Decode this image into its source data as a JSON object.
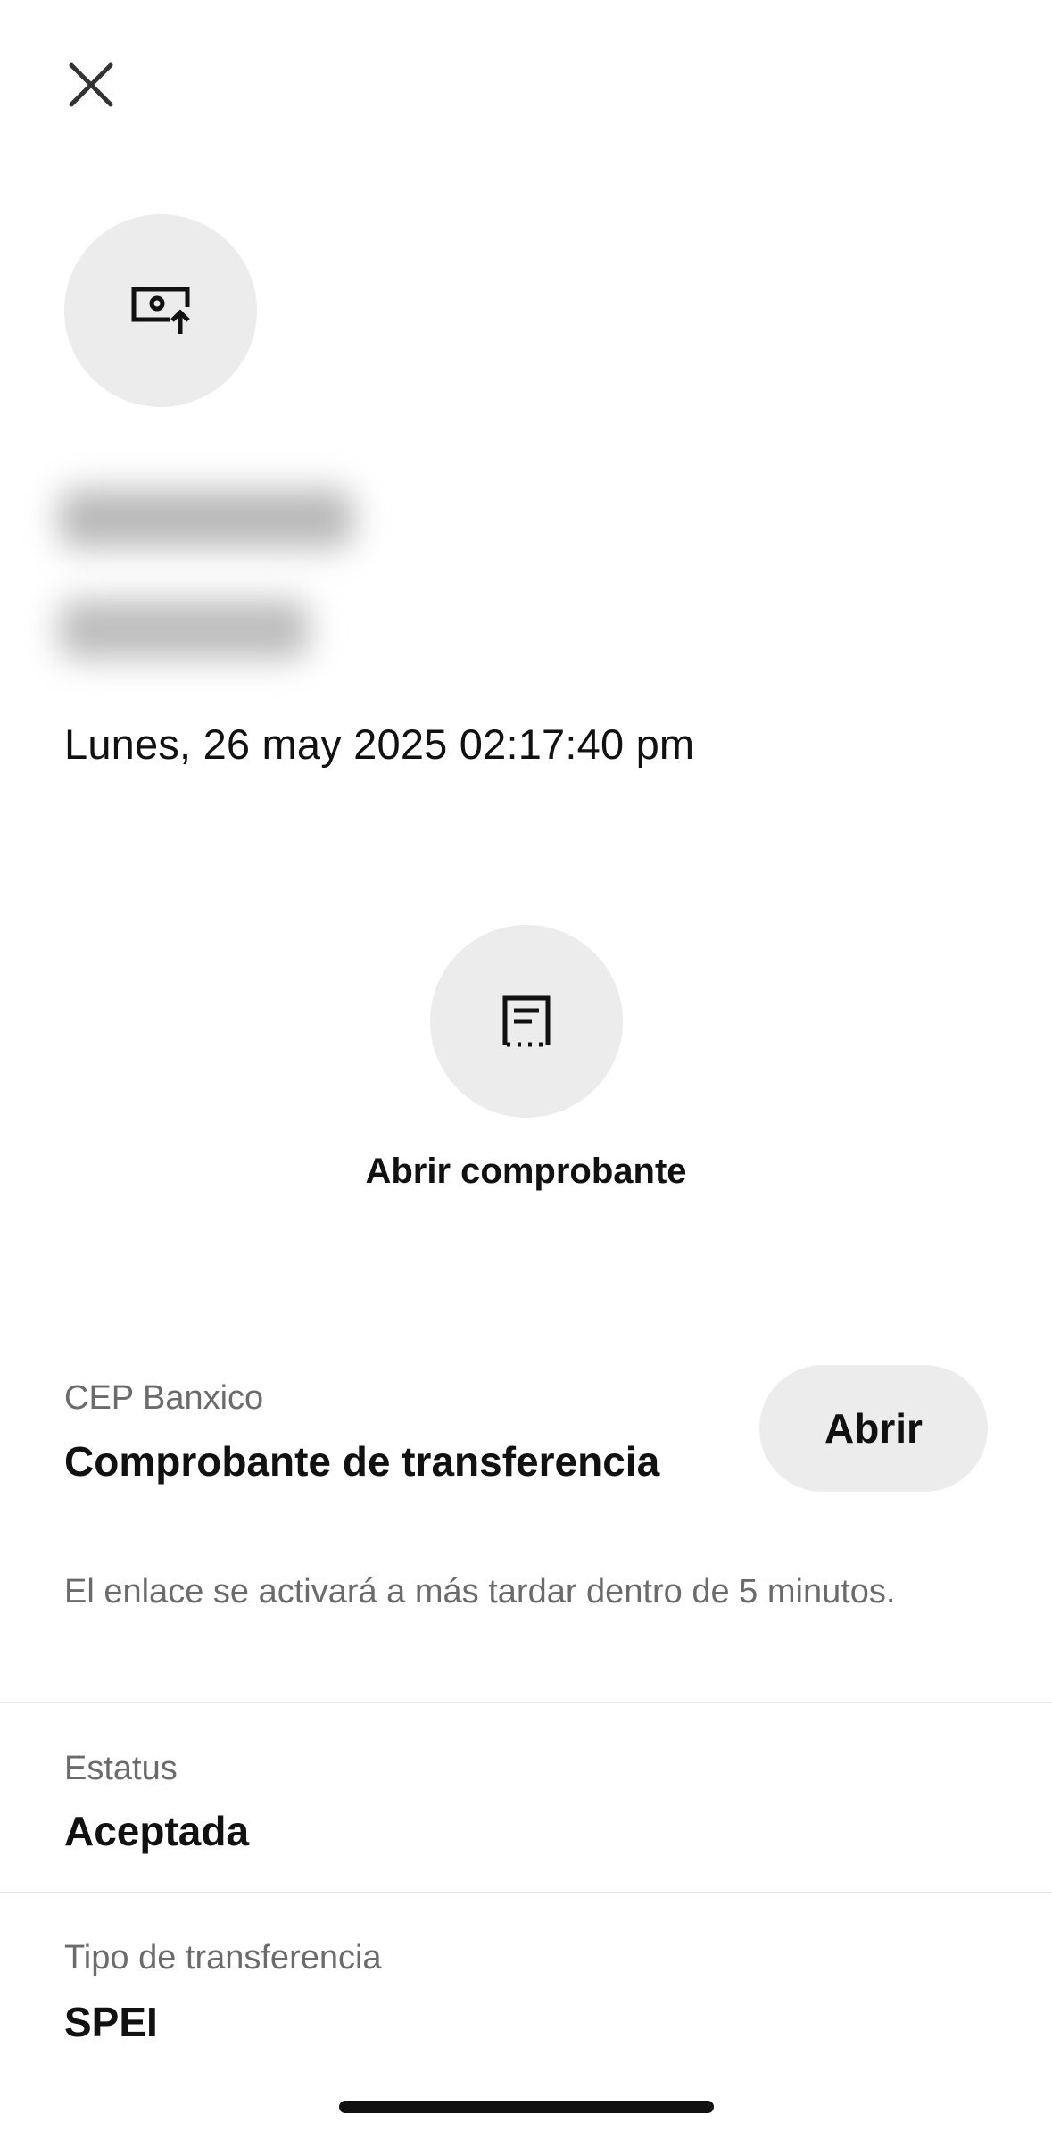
{
  "header": {
    "close_icon": "close-icon"
  },
  "transfer": {
    "type_icon": "money-send-icon",
    "recipient_name": "",
    "amount": "",
    "datetime": "Lunes, 26 may 2025 02:17:40 pm"
  },
  "receipt": {
    "icon": "receipt-icon",
    "label": "Abrir comprobante"
  },
  "cep": {
    "caption": "CEP Banxico",
    "title": "Comprobante de transferencia",
    "button_label": "Abrir",
    "note": "El enlace se activará a más tardar dentro de 5 minutos."
  },
  "details": [
    {
      "label": "Estatus",
      "value": "Aceptada"
    },
    {
      "label": "Tipo de transferencia",
      "value": "SPEI"
    }
  ],
  "colors": {
    "background": "#ffffff",
    "circle_bg": "#ececec",
    "text_primary": "#111111",
    "text_secondary": "#6b6b6b",
    "divider": "#e6e6e6"
  }
}
